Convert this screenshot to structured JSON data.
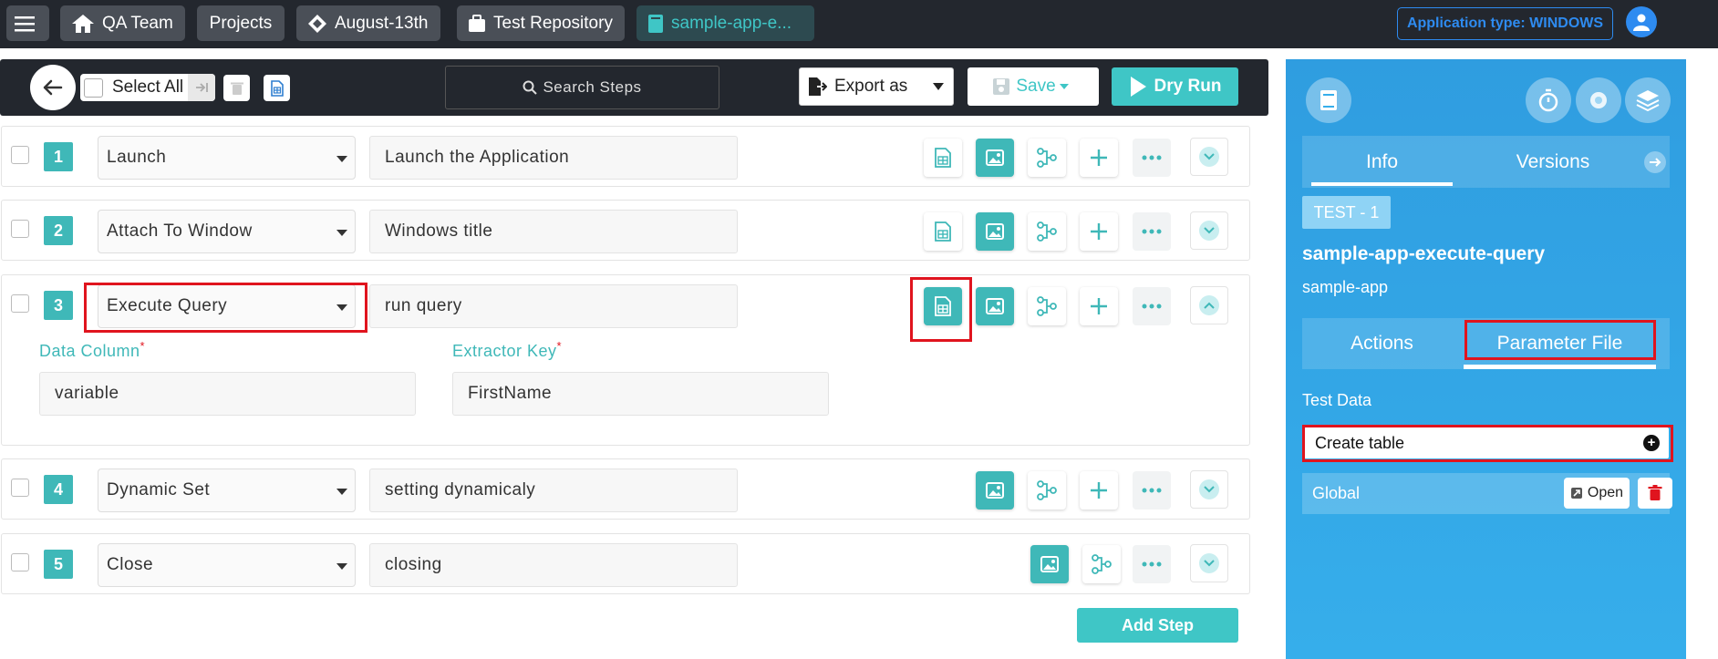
{
  "topbar": {
    "menu_icon": "hamburger-icon",
    "crumbs": [
      "QA Team",
      "Projects",
      "August-13th",
      "Test Repository",
      "sample-app-e..."
    ],
    "app_type": "Application type: WINDOWS"
  },
  "toolbar": {
    "select_all": "Select All",
    "search_placeholder": "Search Steps",
    "export_label": "Export as",
    "save_label": "Save",
    "dryrun_label": "Dry Run"
  },
  "steps": [
    {
      "num": "1",
      "action": "Launch",
      "desc": "Launch the Application"
    },
    {
      "num": "2",
      "action": "Attach To Window",
      "desc": "Windows title"
    },
    {
      "num": "3",
      "action": "Execute Query",
      "desc": "run query"
    },
    {
      "num": "4",
      "action": "Dynamic Set",
      "desc": "setting dynamicaly"
    },
    {
      "num": "5",
      "action": "Close",
      "desc": "closing"
    }
  ],
  "step3_fields": {
    "data_column_label": "Data Column",
    "data_column_value": "variable",
    "extractor_key_label": "Extractor Key",
    "extractor_key_value": "FirstName",
    "required_mark": "*"
  },
  "add_step": "Add Step",
  "panel": {
    "tabs": [
      "Info",
      "Versions"
    ],
    "badge": "TEST - 1",
    "name": "sample-app-execute-query",
    "subname": "sample-app",
    "subtabs": [
      "Actions",
      "Parameter File"
    ],
    "test_data_label": "Test Data",
    "create_table": "Create table",
    "global_label": "Global",
    "open_label": "Open"
  },
  "colors": {
    "teal": "#3fb8b8",
    "panel_blue": "#2f9de0",
    "highlight_red": "#e0141e",
    "topbar": "#23272e"
  }
}
